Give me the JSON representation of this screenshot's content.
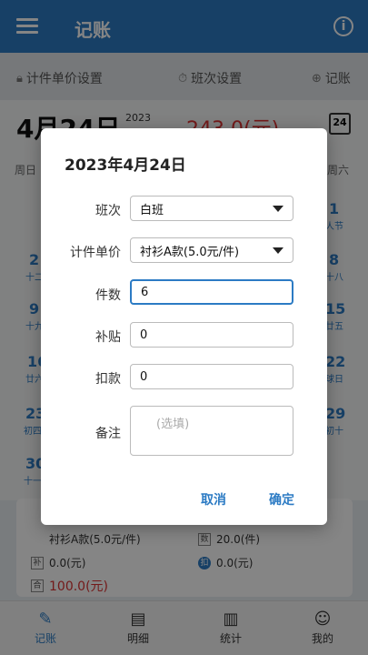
{
  "appbar": {
    "title": "记账",
    "info_glyph": "i"
  },
  "toolbar": {
    "item1": "计件单价设置",
    "item2": "班次设置",
    "item3": "记账"
  },
  "daterow": {
    "big_date": "4月24日",
    "year": "2023",
    "amount": "243.0(元)",
    "cal_day": "24"
  },
  "calendar": {
    "weekday_left": "周日",
    "weekday_right": "周六",
    "cells": [
      {
        "day": "2",
        "sub": "十二"
      },
      {
        "day": "9",
        "sub": "十九"
      },
      {
        "day": "16",
        "sub": "廿六"
      },
      {
        "day": "23",
        "sub": "初四"
      },
      {
        "day": "30",
        "sub": "十一"
      },
      {
        "day": "1",
        "sub": "人节"
      },
      {
        "day": "8",
        "sub": "十八"
      },
      {
        "day": "15",
        "sub": "廿五"
      },
      {
        "day": "22",
        "sub": "球日"
      },
      {
        "day": "29",
        "sub": "初十"
      }
    ]
  },
  "summary": {
    "item": "衬衫A款(5.0元/件)",
    "count": "20.0(件)",
    "allowance": "0.0(元)",
    "deduction": "0.0(元)",
    "total": "100.0(元)",
    "count_box": "数",
    "deduct_glyph": "扣",
    "total_box": "合",
    "allow_box": "补"
  },
  "nav": [
    {
      "label": "记账",
      "icon": "edit-icon"
    },
    {
      "label": "明细",
      "icon": "list-icon"
    },
    {
      "label": "统计",
      "icon": "bar-chart-icon"
    },
    {
      "label": "我的",
      "icon": "user-icon"
    }
  ],
  "dialog": {
    "title": "2023年4月24日",
    "shift_label": "班次",
    "shift_value": "白班",
    "price_label": "计件单价",
    "price_value": "衬衫A款(5.0元/件)",
    "qty_label": "件数",
    "qty_value": "6",
    "allow_label": "补贴",
    "allow_value": "0",
    "deduct_label": "扣款",
    "deduct_value": "0",
    "note_label": "备注",
    "note_placeholder": "(选填)",
    "cancel": "取消",
    "confirm": "确定"
  },
  "colors": {
    "primary": "#2c7bc4",
    "amount_red": "#dd3333"
  }
}
